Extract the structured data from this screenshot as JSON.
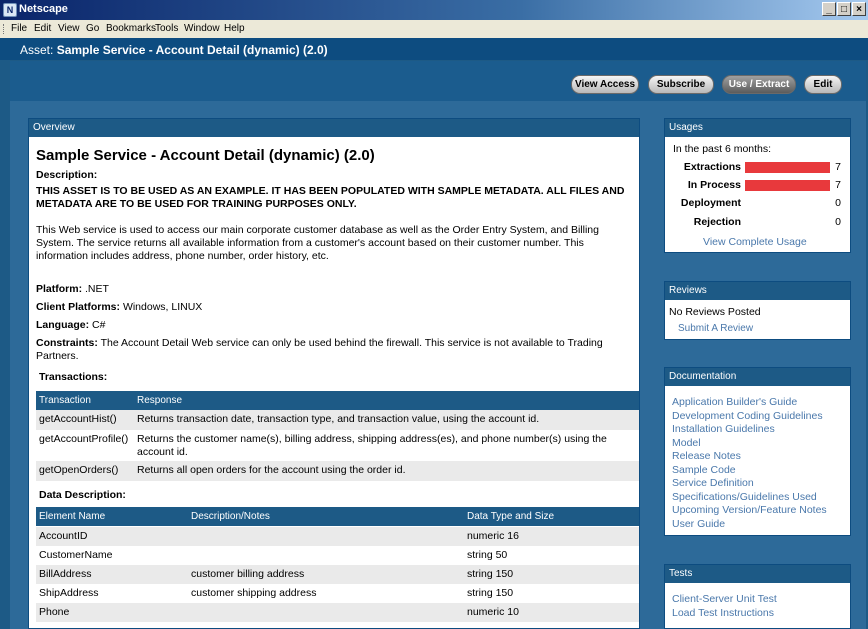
{
  "window": {
    "title": "Netscape"
  },
  "menu": [
    "File",
    "Edit",
    "View",
    "Go",
    "Bookmarks",
    "Tools",
    "Window",
    "Help"
  ],
  "asset": {
    "prefix": "Asset:",
    "name": "Sample Service - Account Detail (dynamic) (2.0)"
  },
  "toolbar": {
    "view_access": "View Access",
    "subscribe": "Subscribe",
    "use_extract": "Use / Extract",
    "edit": "Edit"
  },
  "overview": {
    "header": "Overview",
    "title": "Sample Service - Account Detail (dynamic) (2.0)",
    "description_label": "Description:",
    "description_caps": "THIS ASSET IS TO BE USED AS AN EXAMPLE. IT HAS BEEN POPULATED WITH SAMPLE METADATA. ALL FILES AND METADATA ARE TO BE USED FOR TRAINING PURPOSES ONLY.",
    "description_text": "This Web service is used to access our main corporate customer database as well as the Order Entry System, and Billing System. The service returns all available information from a customer's account based on their customer number. This information includes address, phone number, order history, etc.",
    "platform_label": "Platform:",
    "platform_value": ".NET",
    "client_label": "Client Platforms:",
    "client_value": "Windows, LINUX",
    "language_label": "Language:",
    "language_value": "C#",
    "constraints_label": "Constraints:",
    "constraints_value": "The Account Detail Web service can only be used behind the firewall. This service is not available to Trading Partners.",
    "transactions_label": "Transactions:",
    "transactions_headers": [
      "Transaction",
      "Response"
    ],
    "transactions": [
      {
        "name": "getAccountHist()",
        "response": "Returns transaction date, transaction type, and transaction value, using the account id."
      },
      {
        "name": "getAccountProfile()",
        "response": "Returns the customer name(s), billing address, shipping address(es), and phone number(s) using the account id."
      },
      {
        "name": "getOpenOrders()",
        "response": "Returns all open orders for the account using the order id."
      }
    ],
    "data_label": "Data Description:",
    "data_headers": [
      "Element Name",
      "Description/Notes",
      "Data Type and Size"
    ],
    "data_rows": [
      {
        "name": "AccountID",
        "notes": "",
        "type": "numeric 16"
      },
      {
        "name": "CustomerName",
        "notes": "",
        "type": "string 50"
      },
      {
        "name": "BillAddress",
        "notes": "customer billing address",
        "type": "string 150"
      },
      {
        "name": "ShipAddress",
        "notes": "customer shipping address",
        "type": "string 150"
      },
      {
        "name": "Phone",
        "notes": "",
        "type": "numeric 10"
      }
    ]
  },
  "usages": {
    "header": "Usages",
    "period": "In the past 6 months:",
    "rows": [
      {
        "label": "Extractions",
        "count": "7",
        "fraction": 1.0
      },
      {
        "label": "In Process",
        "count": "7",
        "fraction": 1.0
      },
      {
        "label": "Deployment",
        "count": "0",
        "fraction": 0
      },
      {
        "label": "Rejection",
        "count": "0",
        "fraction": 0
      }
    ],
    "link": "View Complete Usage",
    "bar_color": "#e8393c"
  },
  "reviews": {
    "header": "Reviews",
    "none": "No Reviews Posted",
    "link": "Submit A Review"
  },
  "documentation": {
    "header": "Documentation",
    "items": [
      "Application Builder's Guide",
      "Development Coding Guidelines",
      "Installation Guidelines",
      "Model",
      "Release Notes",
      "Sample Code",
      "Service Definition",
      "Specifications/Guidelines Used",
      "Upcoming Version/Feature Notes",
      "User Guide"
    ]
  },
  "tests": {
    "header": "Tests",
    "items": [
      "Client-Server Unit Test",
      "Load Test Instructions"
    ]
  }
}
